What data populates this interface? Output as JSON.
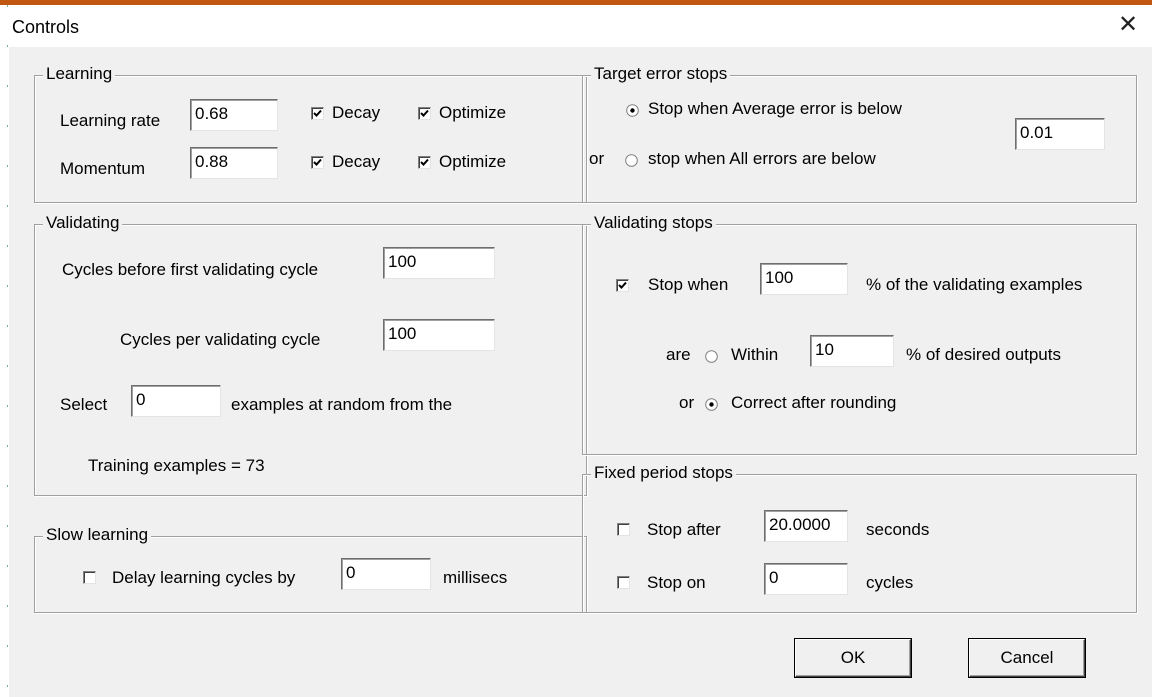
{
  "window": {
    "title": "Controls",
    "close_glyph": "✕"
  },
  "learning": {
    "legend": "Learning",
    "rate_label": "Learning rate",
    "rate_value": "0.68",
    "momentum_label": "Momentum",
    "momentum_value": "0.88",
    "decay_label": "Decay",
    "optimize_label": "Optimize",
    "rate_decay_checked": true,
    "rate_optimize_checked": true,
    "momentum_decay_checked": true,
    "momentum_optimize_checked": true
  },
  "validating": {
    "legend": "Validating",
    "cycles_before_label": "Cycles before first validating cycle",
    "cycles_before_value": "100",
    "cycles_per_label": "Cycles per validating cycle",
    "cycles_per_value": "100",
    "select_label": "Select",
    "select_value": "0",
    "select_suffix": "examples at random from the",
    "training_examples": "Training examples = 73"
  },
  "slow_learning": {
    "legend": "Slow learning",
    "delay_label": "Delay learning cycles by",
    "delay_value": "0",
    "delay_unit": "millisecs",
    "delay_checked": false
  },
  "target_error": {
    "legend": "Target error stops",
    "average_label": "Stop when Average error is below",
    "or_label": "or",
    "all_label": "stop when All errors are below",
    "value": "0.01",
    "selected": "average"
  },
  "validating_stops": {
    "legend": "Validating stops",
    "stop_when_label": "Stop when",
    "stop_when_value": "100",
    "stop_when_suffix": "% of the validating examples",
    "stop_when_checked": true,
    "are_label": "are",
    "within_label": "Within",
    "within_value": "10",
    "within_suffix": "% of desired outputs",
    "or_label": "or",
    "correct_label": "Correct after rounding",
    "selected": "correct"
  },
  "fixed_period": {
    "legend": "Fixed period stops",
    "stop_after_label": "Stop after",
    "stop_after_value": "20.0000",
    "stop_after_unit": "seconds",
    "stop_on_label": "Stop on",
    "stop_on_value": "0",
    "stop_on_unit": "cycles",
    "stop_after_checked": false,
    "stop_on_checked": false
  },
  "buttons": {
    "ok": "OK",
    "cancel": "Cancel"
  }
}
